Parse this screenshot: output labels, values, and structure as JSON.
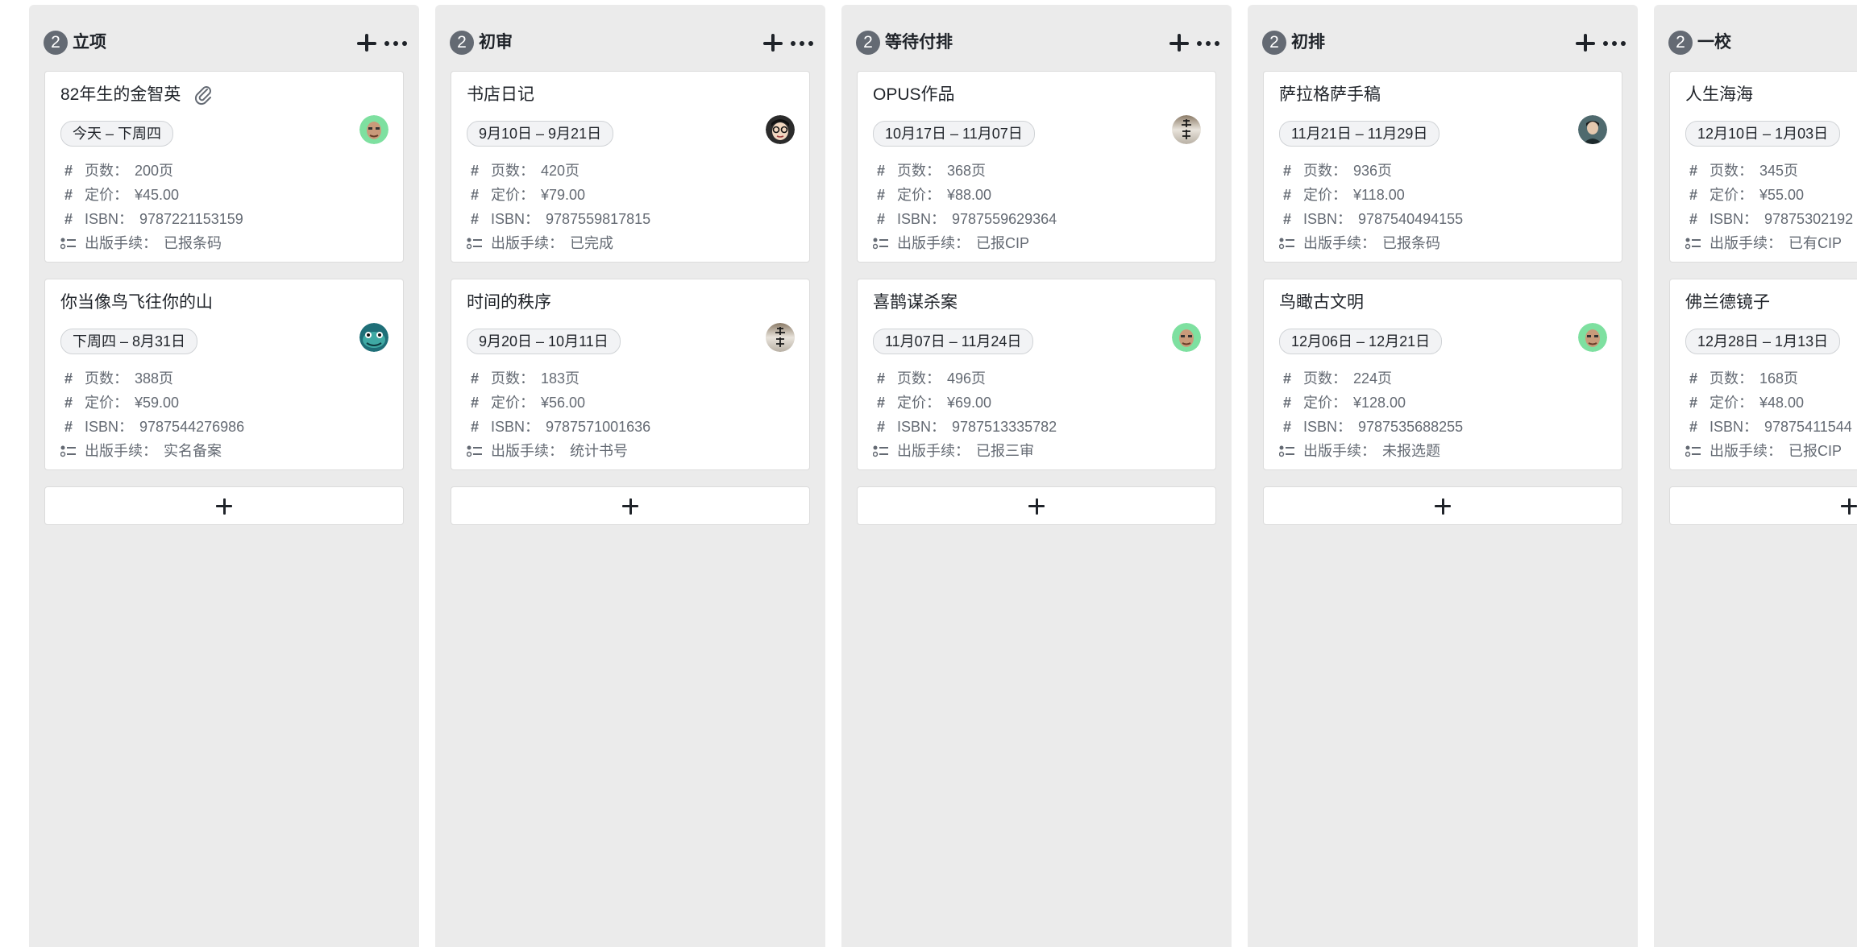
{
  "columns": [
    {
      "count": "2",
      "title": "立项",
      "cards": [
        {
          "title": "82年生的金智英",
          "has_attachment": true,
          "date": "今天 – 下周四",
          "avatar": "avatar-green-face",
          "pages_label": "页数：",
          "pages": "200页",
          "price_label": "定价：",
          "price": "¥45.00",
          "isbn_label": "ISBN：",
          "isbn": "9787221153159",
          "status_label": "出版手续：",
          "status": "已报条码"
        },
        {
          "title": "你当像鸟飞往你的山",
          "has_attachment": false,
          "date": "下周四 – 8月31日",
          "avatar": "avatar-teal-creature",
          "pages_label": "页数：",
          "pages": "388页",
          "price_label": "定价：",
          "price": "¥59.00",
          "isbn_label": "ISBN：",
          "isbn": "9787544276986",
          "status_label": "出版手续：",
          "status": "实名备案"
        }
      ]
    },
    {
      "count": "2",
      "title": "初审",
      "cards": [
        {
          "title": "书店日记",
          "date": "9月10日 – 9月21日",
          "avatar": "avatar-dark-glasses",
          "pages_label": "页数：",
          "pages": "420页",
          "price_label": "定价：",
          "price": "¥79.00",
          "isbn_label": "ISBN：",
          "isbn": "9787559817815",
          "status_label": "出版手续：",
          "status": "已完成"
        },
        {
          "title": "时间的秩序",
          "date": "9月20日 – 10月11日",
          "avatar": "avatar-calligraphy",
          "pages_label": "页数：",
          "pages": "183页",
          "price_label": "定价：",
          "price": "¥56.00",
          "isbn_label": "ISBN：",
          "isbn": "9787571001636",
          "status_label": "出版手续：",
          "status": "统计书号"
        }
      ]
    },
    {
      "count": "2",
      "title": "等待付排",
      "cards": [
        {
          "title": "OPUS作品",
          "date": "10月17日 – 11月07日",
          "avatar": "avatar-calligraphy",
          "pages_label": "页数：",
          "pages": "368页",
          "price_label": "定价：",
          "price": "¥88.00",
          "isbn_label": "ISBN：",
          "isbn": "9787559629364",
          "status_label": "出版手续：",
          "status": "已报CIP"
        },
        {
          "title": "喜鹊谋杀案",
          "date": "11月07日 – 11月24日",
          "avatar": "avatar-green-face",
          "pages_label": "页数：",
          "pages": "496页",
          "price_label": "定价：",
          "price": "¥69.00",
          "isbn_label": "ISBN：",
          "isbn": "9787513335782",
          "status_label": "出版手续：",
          "status": "已报三审"
        }
      ]
    },
    {
      "count": "2",
      "title": "初排",
      "cards": [
        {
          "title": "萨拉格萨手稿",
          "date": "11月21日 – 11月29日",
          "avatar": "avatar-dark-person",
          "pages_label": "页数：",
          "pages": "936页",
          "price_label": "定价：",
          "price": "¥118.00",
          "isbn_label": "ISBN：",
          "isbn": "9787540494155",
          "status_label": "出版手续：",
          "status": "已报条码"
        },
        {
          "title": "鸟瞰古文明",
          "date": "12月06日 – 12月21日",
          "avatar": "avatar-green-face",
          "pages_label": "页数：",
          "pages": "224页",
          "price_label": "定价：",
          "price": "¥128.00",
          "isbn_label": "ISBN：",
          "isbn": "9787535688255",
          "status_label": "出版手续：",
          "status": "未报选题"
        }
      ]
    },
    {
      "count": "2",
      "title": "一校",
      "cards": [
        {
          "title": "人生海海",
          "date": "12月10日 – 1月03日",
          "pages_label": "页数：",
          "pages": "345页",
          "price_label": "定价：",
          "price": "¥55.00",
          "isbn_label": "ISBN：",
          "isbn": "97875302192",
          "status_label": "出版手续：",
          "status": "已有CIP"
        },
        {
          "title": "佛兰德镜子",
          "date": "12月28日 – 1月13日",
          "pages_label": "页数：",
          "pages": "168页",
          "price_label": "定价：",
          "price": "¥48.00",
          "isbn_label": "ISBN：",
          "isbn": "97875411544",
          "status_label": "出版手续：",
          "status": "已报CIP"
        }
      ]
    }
  ]
}
